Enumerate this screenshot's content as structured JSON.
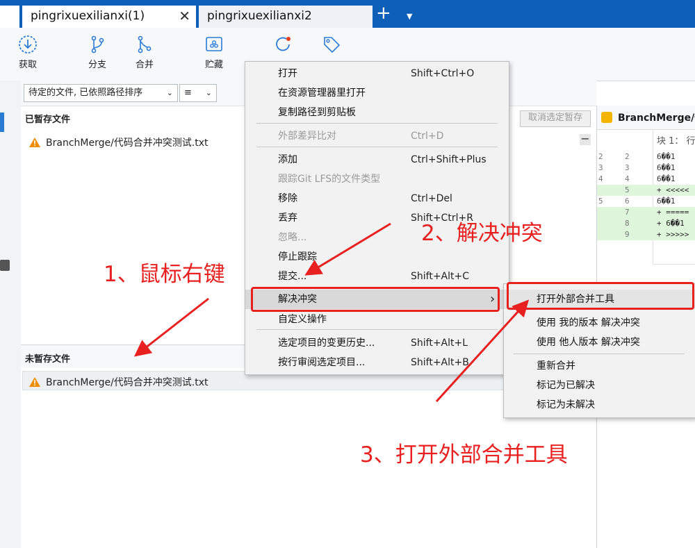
{
  "tabs": [
    {
      "label": "pingrixuexilianxi(1)",
      "close": "✕"
    },
    {
      "label": "pingrixuexilianxi2"
    }
  ],
  "tabbar": {
    "add": "+",
    "menu": "▼"
  },
  "toolbar": {
    "fetch": "获取",
    "branch": "分支",
    "merge": "合并",
    "stash": "贮藏"
  },
  "filter": {
    "sort_select": "待定的文件, 已依照路径排序",
    "view_select": "≡"
  },
  "staged": {
    "title": "已暂存文件",
    "file": "BranchMerge/代码合并冲突测试.txt",
    "unstage_button": "取消选定暂存",
    "collapse": "−"
  },
  "unstaged": {
    "title": "未暂存文件",
    "file": "BranchMerge/代码合并冲突测试.txt"
  },
  "diff": {
    "file_title": "BranchMerge/代",
    "hunk": "块 1： 行",
    "lines": [
      {
        "n1": "2",
        "n2": "2",
        "text": "6��1",
        "add": false
      },
      {
        "n1": "3",
        "n2": "3",
        "text": "6��1",
        "add": false
      },
      {
        "n1": "4",
        "n2": "4",
        "text": "6��1",
        "add": false
      },
      {
        "n1": "",
        "n2": "5",
        "text": "+ <<<<<",
        "add": true
      },
      {
        "n1": "5",
        "n2": "6",
        "text": "6��1",
        "add": false
      },
      {
        "n1": "",
        "n2": "7",
        "text": "+ =====",
        "add": true
      },
      {
        "n1": "",
        "n2": "8",
        "text": "+ 6��1",
        "add": true
      },
      {
        "n1": "",
        "n2": "9",
        "text": "+ >>>>>",
        "add": true
      }
    ]
  },
  "context_menu": {
    "items": [
      {
        "label": "打开",
        "shortcut": "Shift+Ctrl+O"
      },
      {
        "label": "在资源管理器里打开",
        "shortcut": ""
      },
      {
        "label": "复制路径到剪贴板",
        "shortcut": ""
      },
      {
        "label": "外部差异比对",
        "shortcut": "Ctrl+D"
      },
      {
        "label": "添加",
        "shortcut": "Ctrl+Shift+Plus"
      },
      {
        "label": "跟踪Git LFS的文件类型",
        "shortcut": ""
      },
      {
        "label": "移除",
        "shortcut": "Ctrl+Del"
      },
      {
        "label": "丢弃",
        "shortcut": "Shift+Ctrl+R"
      },
      {
        "label": "忽略...",
        "shortcut": ""
      },
      {
        "label": "停止跟踪",
        "shortcut": ""
      },
      {
        "label": "提交...",
        "shortcut": "Shift+Alt+C"
      },
      {
        "label": "解决冲突",
        "shortcut": "›"
      },
      {
        "label": "自定义操作",
        "shortcut": ""
      },
      {
        "label": "选定项目的变更历史...",
        "shortcut": "Shift+Alt+L"
      },
      {
        "label": "按行审阅选定项目...",
        "shortcut": "Shift+Alt+B"
      }
    ]
  },
  "submenu": {
    "items": [
      {
        "label": "打开外部合并工具"
      },
      {
        "label": "使用 我的版本 解决冲突"
      },
      {
        "label": "使用 他人版本 解决冲突"
      },
      {
        "label": "重新合并"
      },
      {
        "label": "标记为已解决"
      },
      {
        "label": "标记为未解决"
      }
    ]
  },
  "annotations": {
    "step1": "1、鼠标右键",
    "step2": "2、解决冲突",
    "step3": "3、打开外部合并工具"
  },
  "colors": {
    "accent": "#0d5fb8",
    "annotation": "#e8201f",
    "warning": "#f08c00"
  }
}
